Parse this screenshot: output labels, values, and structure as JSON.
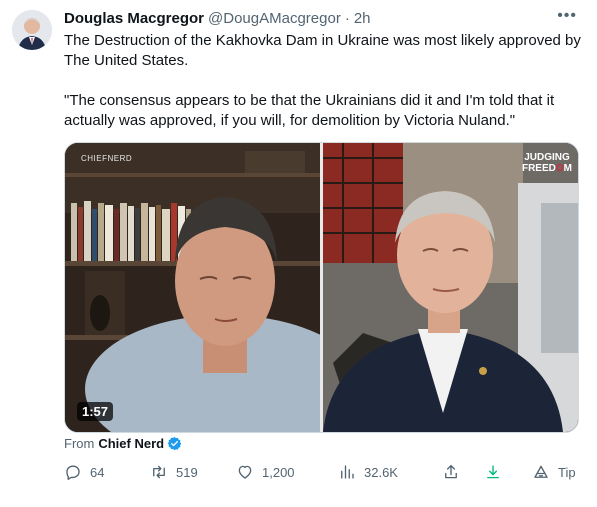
{
  "author": {
    "name": "Douglas Macgregor",
    "handle": "@DougAMacgregor",
    "separator": "·",
    "time": "2h"
  },
  "tweet": {
    "paragraph1": "The Destruction of the Kakhovka Dam in Ukraine was most likely approved by The United States.",
    "paragraph2": "\"The consensus appears to be that the Ukrainians did it and I'm told that it actually was approved, if you will, for demolition by Victoria Nuland.\""
  },
  "media": {
    "watermark": "CHIEFNERD",
    "logo_line1": "JUDGING",
    "logo_line2_a": "FREED",
    "logo_line2_b": "O",
    "logo_line2_c": "M",
    "duration": "1:57"
  },
  "source": {
    "prefix": "From",
    "name": "Chief Nerd"
  },
  "actions": {
    "replies": "64",
    "retweets": "519",
    "likes": "1,200",
    "views": "32.6K",
    "tip": "Tip"
  },
  "colors": {
    "text": "#0f1419",
    "secondary": "#536471",
    "verified": "#1d9bf0",
    "download": "#00ba7c",
    "logo_accent": "#d7263d"
  }
}
